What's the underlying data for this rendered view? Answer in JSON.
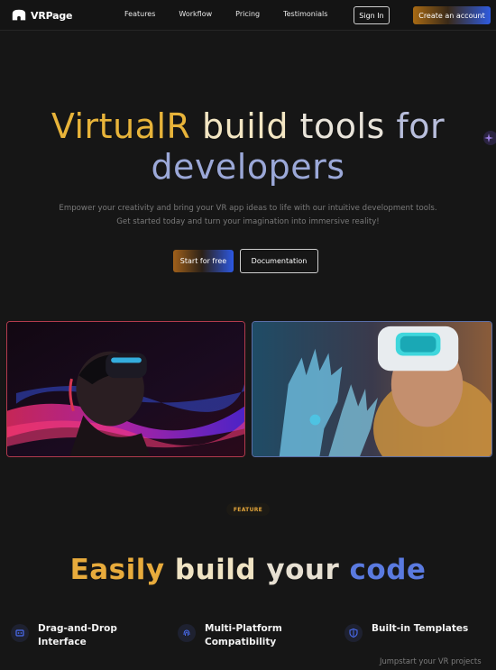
{
  "nav": {
    "brand": "VRPage",
    "links": [
      "Features",
      "Workflow",
      "Pricing",
      "Testimonials"
    ],
    "signin": "Sign In",
    "create_account": "Create an account"
  },
  "hero": {
    "title_parts": [
      "VirtualR",
      "build",
      "tools",
      "for",
      "developers"
    ],
    "subtitle_line1": "Empower your creativity and bring your VR app ideas to life with our intuitive development tools.",
    "subtitle_line2": "Get started today and turn your imagination into immersive reality!",
    "cta_primary": "Start for free",
    "cta_secondary": "Documentation"
  },
  "feature_section": {
    "badge": "FEATURE",
    "title_parts": [
      "Easily",
      "build",
      "your",
      "code"
    ],
    "items": [
      {
        "label_line1": "Drag-and-Drop",
        "label_line2": "Interface",
        "icon": "drag-icon"
      },
      {
        "label_line1": "Multi-Platform",
        "label_line2": "Compatibility",
        "icon": "fingerprint-icon"
      },
      {
        "label_line1": "Built-in Templates",
        "label_line2": "",
        "icon": "shield-icon"
      }
    ],
    "template_desc": "Jumpstart your VR projects"
  },
  "colors": {
    "accent_orange": "#e8b43a",
    "accent_blue": "#2f5be0",
    "background": "#161616"
  }
}
